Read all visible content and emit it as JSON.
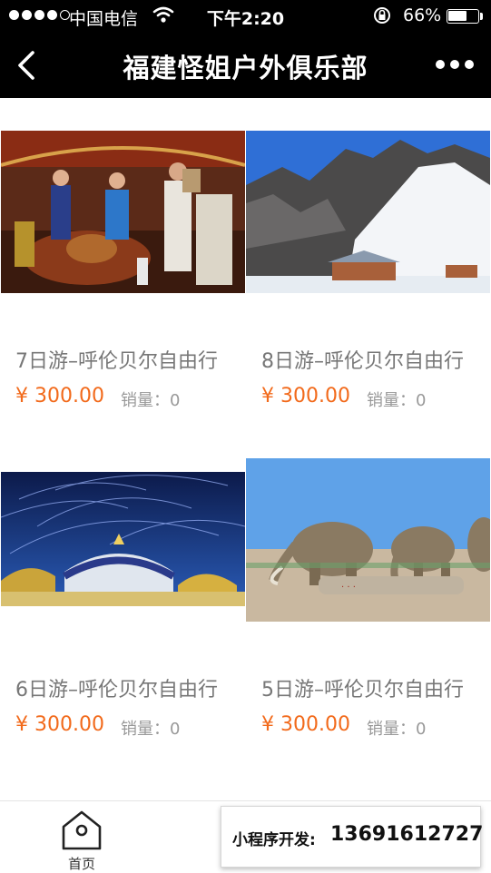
{
  "status_bar": {
    "carrier": "中国电信",
    "time": "下午2:20",
    "battery": "66%",
    "battery_level": 0.66
  },
  "nav": {
    "title": "福建怪姐户外俱乐部"
  },
  "products": [
    {
      "name": "7日游–呼伦贝尔自由行",
      "price": "¥ 300.00",
      "sales_label": "销量：",
      "sales": "0",
      "image": "yurt-banquet-photo"
    },
    {
      "name": "8日游–呼伦贝尔自由行",
      "price": "¥ 300.00",
      "sales_label": "销量：",
      "sales": "0",
      "image": "snowy-rock-mountain-photo"
    },
    {
      "name": "6日游–呼伦贝尔自由行",
      "price": "¥ 300.00",
      "sales_label": "销量：",
      "sales": "0",
      "image": "star-trail-night-photo"
    },
    {
      "name": "5日游–呼伦贝尔自由行",
      "price": "¥ 300.00",
      "sales_label": "销量：",
      "sales": "0",
      "image": "mammoth-statues-photo"
    }
  ],
  "tabbar": {
    "home_label": "首页"
  },
  "promo": {
    "label": "小程序开发:",
    "phone": "13691612727"
  }
}
